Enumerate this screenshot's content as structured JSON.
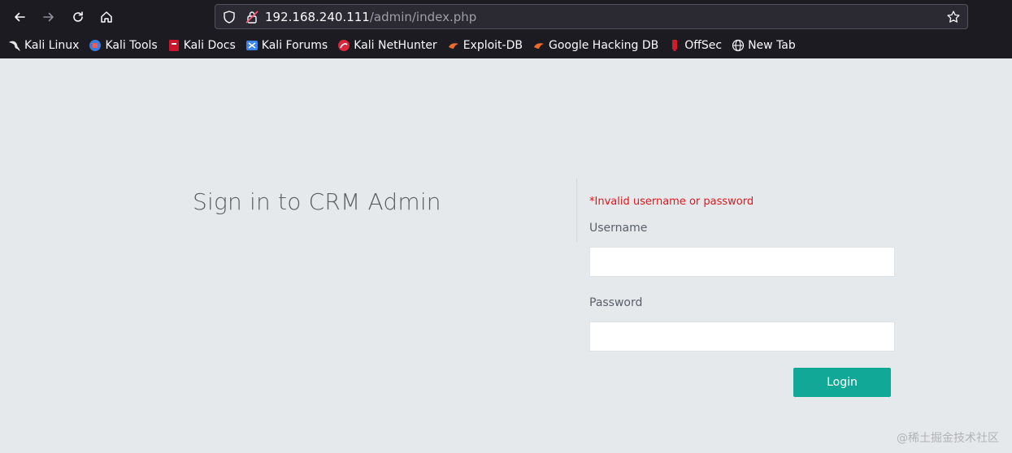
{
  "browser": {
    "url_host": "192.168.240.111",
    "url_path": "/admin/index.php",
    "bookmarks": [
      {
        "label": "Kali Linux",
        "icon": "kali-dragon-icon"
      },
      {
        "label": "Kali Tools",
        "icon": "kali-tools-icon"
      },
      {
        "label": "Kali Docs",
        "icon": "kali-docs-icon"
      },
      {
        "label": "Kali Forums",
        "icon": "kali-forums-icon"
      },
      {
        "label": "Kali NetHunter",
        "icon": "nethunter-icon"
      },
      {
        "label": "Exploit-DB",
        "icon": "exploit-db-icon"
      },
      {
        "label": "Google Hacking DB",
        "icon": "ghdb-icon"
      },
      {
        "label": "OffSec",
        "icon": "offsec-icon"
      },
      {
        "label": "New Tab",
        "icon": "globe-icon"
      }
    ]
  },
  "login": {
    "title": "Sign in to CRM Admin",
    "error": "*Invalid username or password",
    "username_label": "Username",
    "username_value": "",
    "password_label": "Password",
    "password_value": "",
    "submit_label": "Login"
  },
  "watermark": "@稀土掘金技术社区",
  "colors": {
    "page_bg": "#e6e9ec",
    "accent": "#11a897",
    "error": "#e3141b",
    "chrome_bg": "#1c1b22"
  }
}
